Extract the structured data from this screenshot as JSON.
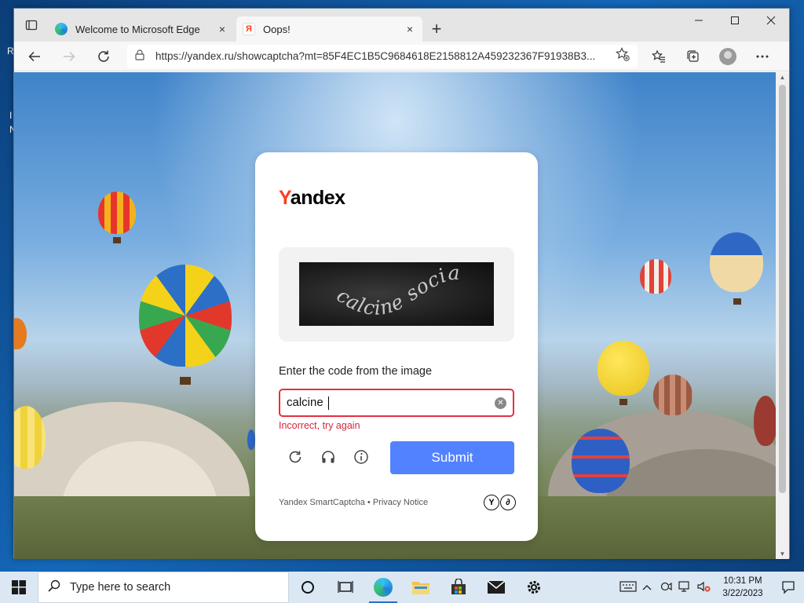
{
  "desktop": {
    "left_letters": [
      "R",
      "I",
      "N"
    ]
  },
  "browser": {
    "tabs": [
      {
        "title": "Welcome to Microsoft Edge",
        "favicon": "edge-logo",
        "active": false
      },
      {
        "title": "Oops!",
        "favicon": "yandex-logo",
        "active": true
      }
    ],
    "close_tab_glyph": "×",
    "new_tab_glyph": "+",
    "address_url": "https://yandex.ru/showcaptcha?mt=85F4EC1B5C9684618E2158812A459232367F91938B3..."
  },
  "captcha": {
    "brand_first": "Y",
    "brand_rest": "andex",
    "image_text": "calcine social",
    "prompt": "Enter the code from the image",
    "input_value": "calcine ",
    "error_message": "Incorrect, try again",
    "submit_label": "Submit",
    "footer": "Yandex SmartCaptcha • Privacy Notice",
    "logo_letters": [
      "Y",
      "∂"
    ],
    "error_color": "#d9253a",
    "submit_color": "#5282ff"
  },
  "taskbar": {
    "search_placeholder": "Type here to search",
    "time": "10:31 PM",
    "date": "3/22/2023"
  }
}
